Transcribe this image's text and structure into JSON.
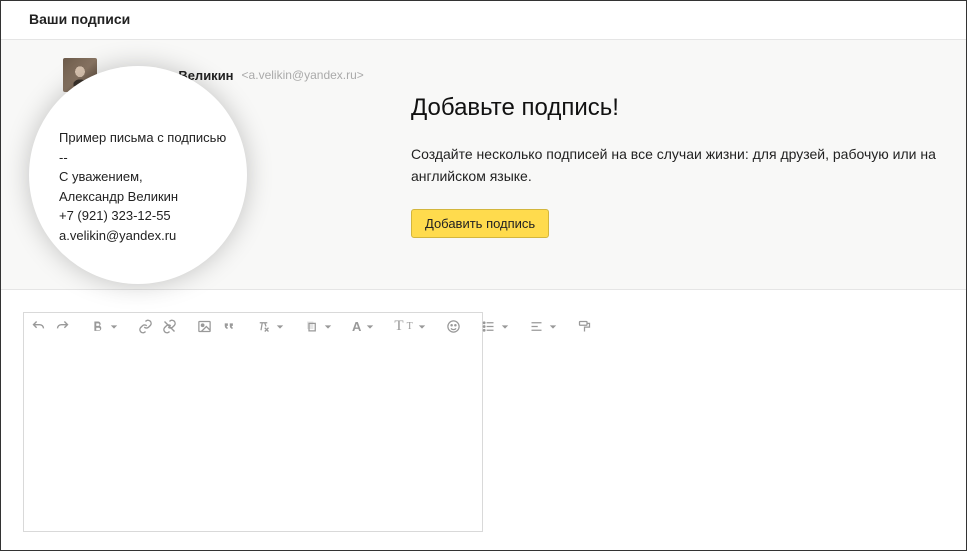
{
  "header": {
    "title": "Ваши подписи"
  },
  "preview": {
    "sender_name": "Александр Великин",
    "sender_email": "<a.velikin@yandex.ru>",
    "sample_subject": "Пример письма с подписью",
    "sep": "--",
    "line1": "С уважением,",
    "line2": "Александр Великин",
    "line3": "+7 (921) 323-12-55",
    "line4": "a.velikin@yandex.ru"
  },
  "promo": {
    "heading": "Добавьте подпись!",
    "para": "Создайте несколько подписей на все случаи жизни: для друзей, рабочую или на английском языке.",
    "button": "Добавить подпись"
  },
  "toolbar": {
    "a_label": "A",
    "tt_big": "T",
    "tt_small": "T"
  }
}
